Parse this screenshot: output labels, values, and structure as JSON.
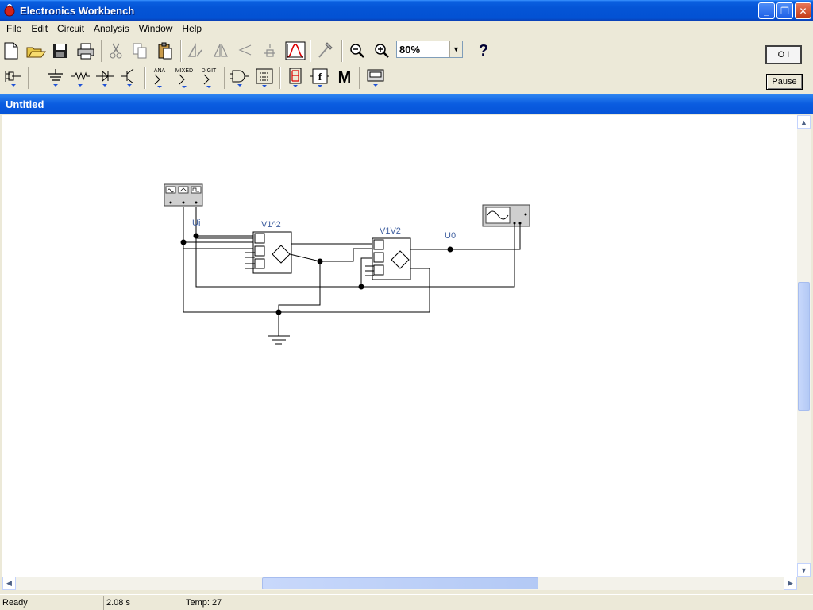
{
  "window": {
    "title": "Electronics Workbench",
    "controls": {
      "minimize": "_",
      "maximize": "❐",
      "close": "✕"
    }
  },
  "menu": [
    {
      "label": "File"
    },
    {
      "label": "Edit"
    },
    {
      "label": "Circuit"
    },
    {
      "label": "Analysis"
    },
    {
      "label": "Window"
    },
    {
      "label": "Help"
    }
  ],
  "toolbar": {
    "zoom_value": "80%",
    "help_label": "?"
  },
  "parts_bin": {
    "analog_label": "ANA",
    "mixed_label": "MIXED",
    "digital_label": "DIGIT",
    "misc_label": "M"
  },
  "simulation": {
    "power_label": "O I",
    "pause_label": "Pause"
  },
  "document": {
    "title": "Untitled"
  },
  "circuit": {
    "labels": {
      "input": "Ui",
      "multiplier1": "V1^2",
      "multiplier2": "V1V2",
      "output": "U0"
    }
  },
  "status": {
    "state": "Ready",
    "time": "2.08 s",
    "temp": "Temp:  27"
  }
}
